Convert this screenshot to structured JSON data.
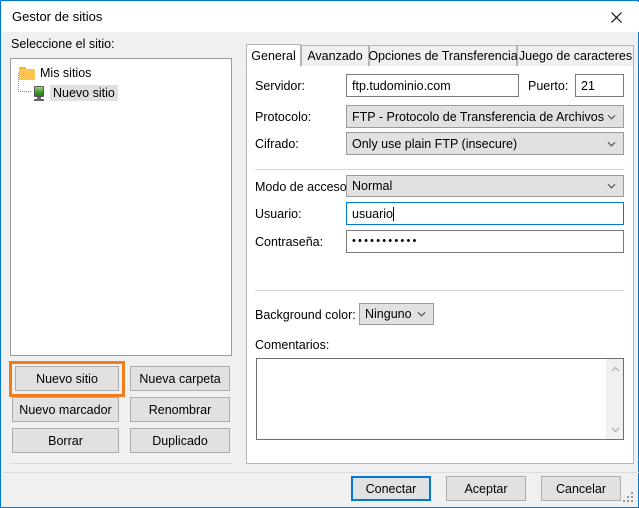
{
  "window": {
    "title": "Gestor de sitios",
    "close_icon": "close-icon",
    "accent_color": "#0078d7",
    "highlight_color": "#f07c1e"
  },
  "left_panel": {
    "label": "Seleccione el sitio:",
    "tree": {
      "root": {
        "label": "Mis sitios",
        "icon": "folder-icon"
      },
      "children": [
        {
          "label": "Nuevo sitio",
          "icon": "server-icon",
          "selected": true
        }
      ]
    },
    "buttons": [
      {
        "label": "Nuevo sitio",
        "highlighted": true
      },
      {
        "label": "Nueva carpeta"
      },
      {
        "label": "Nuevo marcador"
      },
      {
        "label": "Renombrar"
      },
      {
        "label": "Borrar"
      },
      {
        "label": "Duplicado"
      }
    ]
  },
  "tabs": [
    {
      "label": "General",
      "active": true
    },
    {
      "label": "Avanzado",
      "active": false
    },
    {
      "label": "Opciones de Transferencia",
      "active": false
    },
    {
      "label": "Juego de caracteres",
      "active": false
    }
  ],
  "general_tab": {
    "server": {
      "label": "Servidor:",
      "value": "ftp.tudominio.com"
    },
    "port": {
      "label": "Puerto:",
      "value": "21"
    },
    "protocol": {
      "label": "Protocolo:",
      "value": "FTP - Protocolo de Transferencia de Archivos"
    },
    "encryption": {
      "label": "Cifrado:",
      "value": "Only use plain FTP (insecure)"
    },
    "logon_type": {
      "label": "Modo de acceso:",
      "value": "Normal"
    },
    "user": {
      "label": "Usuario:",
      "value": "usuario",
      "focused": true
    },
    "password": {
      "label": "Contraseña:",
      "value": "•••••••••••"
    },
    "background_color": {
      "label": "Background color:",
      "value": "Ninguno"
    },
    "comments": {
      "label": "Comentarios:",
      "value": ""
    }
  },
  "footer": {
    "connect": "Conectar",
    "ok": "Aceptar",
    "cancel": "Cancelar"
  }
}
